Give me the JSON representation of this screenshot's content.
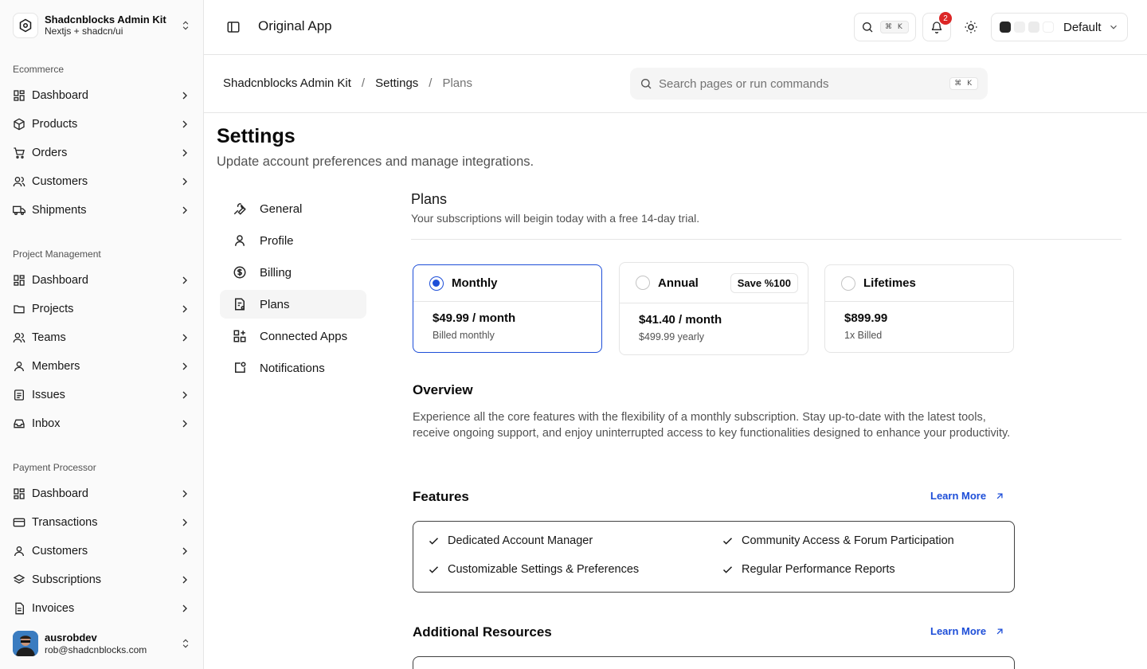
{
  "team": {
    "name": "Shadcnblocks Admin Kit",
    "subtitle": "Nextjs + shadcn/ui"
  },
  "sidebar": {
    "groups": [
      {
        "label": "Ecommerce",
        "items": [
          "Dashboard",
          "Products",
          "Orders",
          "Customers",
          "Shipments"
        ]
      },
      {
        "label": "Project Management",
        "items": [
          "Dashboard",
          "Projects",
          "Teams",
          "Members",
          "Issues",
          "Inbox"
        ]
      },
      {
        "label": "Payment Processor",
        "items": [
          "Dashboard",
          "Transactions",
          "Customers",
          "Subscriptions",
          "Invoices"
        ]
      }
    ]
  },
  "user": {
    "name": "ausrobdev",
    "email": "rob@shadcnblocks.com"
  },
  "header": {
    "app_title": "Original App",
    "search_kbd": "⌘ K",
    "notification_count": "2",
    "theme_label": "Default",
    "theme_swatches": [
      "#262626",
      "#f0f0f0",
      "#ebebeb",
      "#ffffff"
    ]
  },
  "breadcrumb": {
    "items": [
      "Shadcnblocks Admin Kit",
      "Settings",
      "Plans"
    ],
    "separator": "/"
  },
  "command": {
    "placeholder": "Search pages or run commands",
    "kbd": "⌘ K"
  },
  "page": {
    "title": "Settings",
    "subtitle": "Update account preferences and manage integrations."
  },
  "settings_nav": {
    "items": [
      "General",
      "Profile",
      "Billing",
      "Plans",
      "Connected Apps",
      "Notifications"
    ],
    "active": "Plans"
  },
  "plans": {
    "title": "Plans",
    "subtitle": "Your subscriptions will beigin today with a free 14-day trial.",
    "options": [
      {
        "name": "Monthly",
        "price": "$49.99 / month",
        "note": "Billed monthly",
        "selected": true,
        "badge": ""
      },
      {
        "name": "Annual",
        "price": "$41.40 / month",
        "note": "$499.99 yearly",
        "selected": false,
        "badge": "Save %100"
      },
      {
        "name": "Lifetimes",
        "price": "$899.99",
        "note": "1x Billed",
        "selected": false,
        "badge": ""
      }
    ]
  },
  "overview": {
    "title": "Overview",
    "text": "Experience all the core features with the flexibility of a monthly subscription. Stay up-to-date with the latest tools, receive ongoing support, and enjoy uninterrupted access to key functionalities designed to enhance your productivity."
  },
  "features": {
    "title": "Features",
    "learn_more": "Learn More",
    "items": [
      "Dedicated Account Manager",
      "Community Access & Forum Participation",
      "Customizable Settings & Preferences",
      "Regular Performance Reports"
    ]
  },
  "resources": {
    "title": "Additional Resources",
    "learn_more": "Learn More"
  },
  "colors": {
    "accent": "#1d4ed8",
    "badge": "#dc2626",
    "border": "#e5e5e5"
  }
}
